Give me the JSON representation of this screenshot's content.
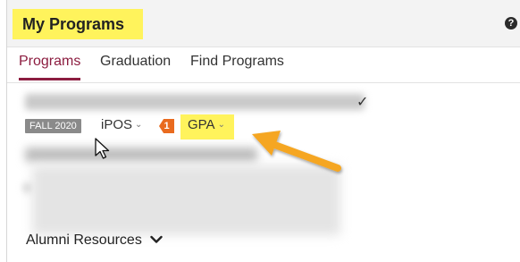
{
  "header": {
    "title": "My Programs",
    "help_icon_glyph": "?",
    "highlight_color": "#fff35c"
  },
  "tabs": [
    {
      "label": "Programs",
      "active": true
    },
    {
      "label": "Graduation",
      "active": false
    },
    {
      "label": "Find Programs",
      "active": false
    }
  ],
  "program": {
    "term_badge": "FALL 2020",
    "ipos_label": "iPOS",
    "ipos_chevron": "⌄",
    "notification_count": "1",
    "gpa_label": "GPA",
    "gpa_chevron": "⌄",
    "check_glyph": "✓"
  },
  "resources": {
    "label": "Alumni Resources"
  },
  "colors": {
    "accent": "#8c1d40",
    "badge_orange": "#e96b1f",
    "term_badge_gray": "#8a8a8a",
    "annotation_arrow": "#f5a623"
  },
  "icons": [
    "help-icon",
    "check-icon",
    "chevron-down-icon",
    "mouse-cursor-icon",
    "annotation-arrow-icon"
  ]
}
